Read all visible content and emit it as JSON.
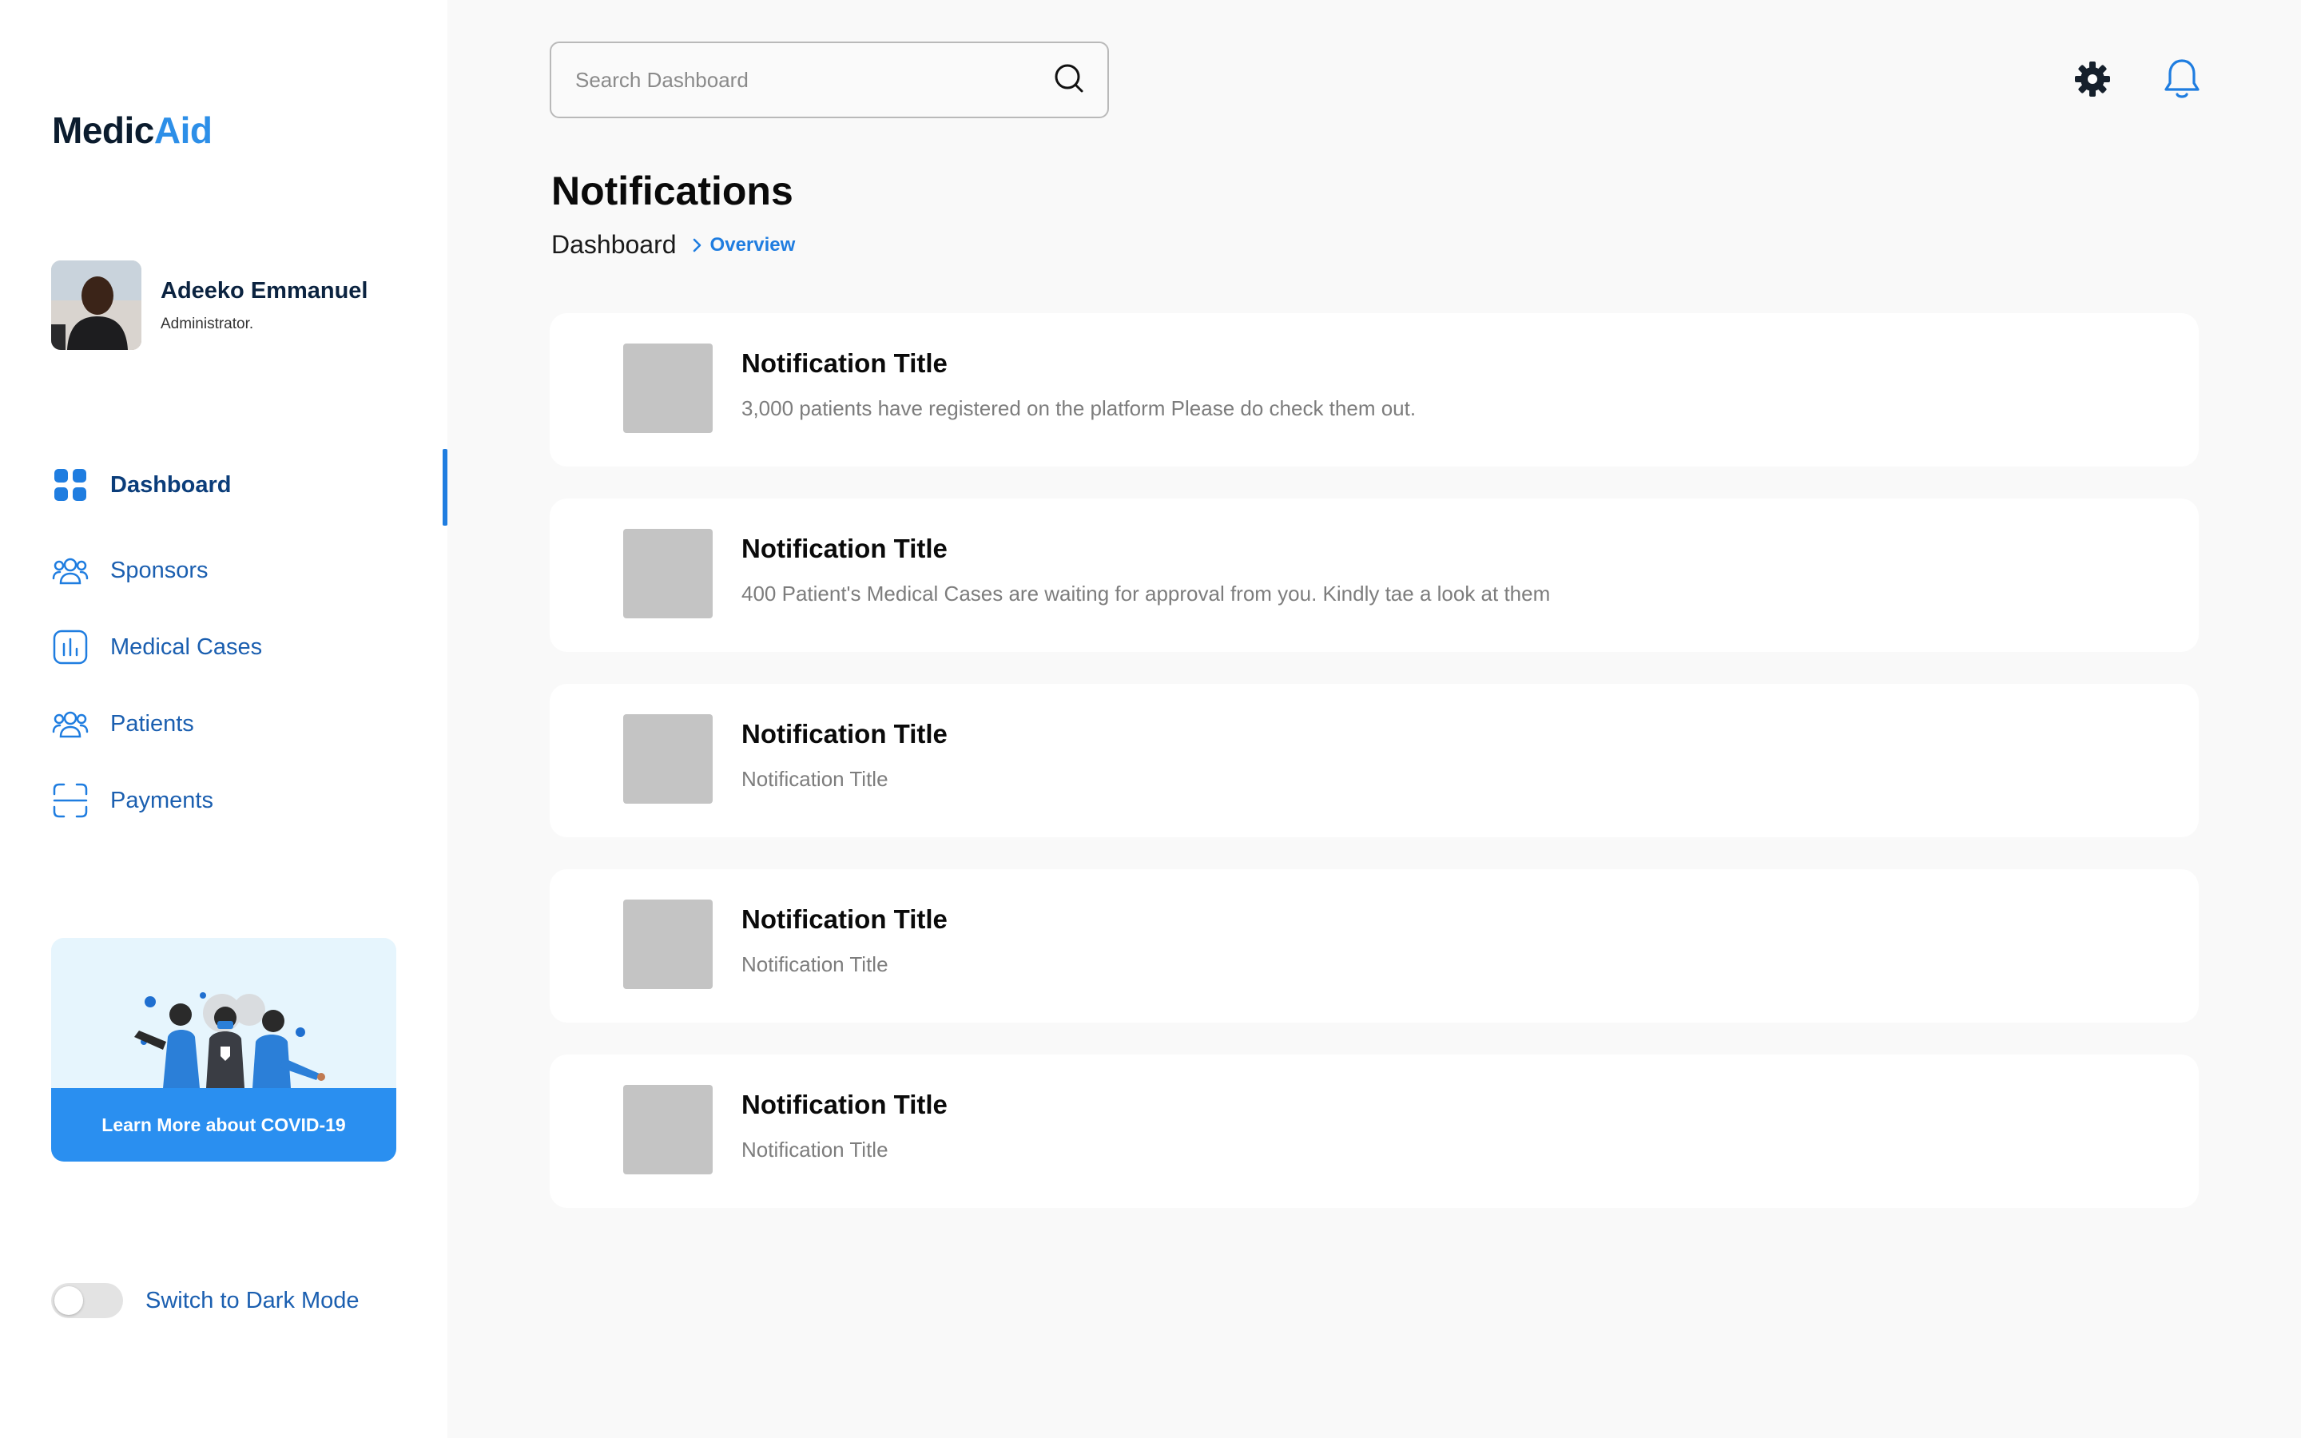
{
  "app": {
    "logo_primary": "Medic",
    "logo_accent": "Aid"
  },
  "profile": {
    "name": "Adeeko Emmanuel",
    "role": "Administrator."
  },
  "sidebar": {
    "items": [
      {
        "label": "Dashboard",
        "icon": "grid-icon",
        "active": true
      },
      {
        "label": "Sponsors",
        "icon": "users-icon",
        "active": false
      },
      {
        "label": "Medical Cases",
        "icon": "bar-chart-icon",
        "active": false
      },
      {
        "label": "Patients",
        "icon": "users-icon",
        "active": false
      },
      {
        "label": "Payments",
        "icon": "scan-icon",
        "active": false
      }
    ],
    "covid_button": "Learn More about COVID-19",
    "dark_mode_label": "Switch to Dark Mode",
    "dark_mode_on": false
  },
  "header": {
    "search_placeholder": "Search Dashboard"
  },
  "page": {
    "title": "Notifications",
    "breadcrumb_root": "Dashboard",
    "breadcrumb_current": "Overview"
  },
  "notifications": [
    {
      "title": "Notification Title",
      "body": "3,000 patients have registered on the platform Please do check them out."
    },
    {
      "title": "Notification Title",
      "body": "400 Patient's Medical Cases are waiting for approval from you. Kindly tae a look at them"
    },
    {
      "title": "Notification Title",
      "body": "Notification Title"
    },
    {
      "title": "Notification Title",
      "body": "Notification Title"
    },
    {
      "title": "Notification Title",
      "body": "Notification Title"
    }
  ],
  "colors": {
    "accent": "#1f7de0",
    "nav_text": "#1b5fb0",
    "page_bg": "#f9f9f9",
    "thumb": "#c4c4c4"
  }
}
